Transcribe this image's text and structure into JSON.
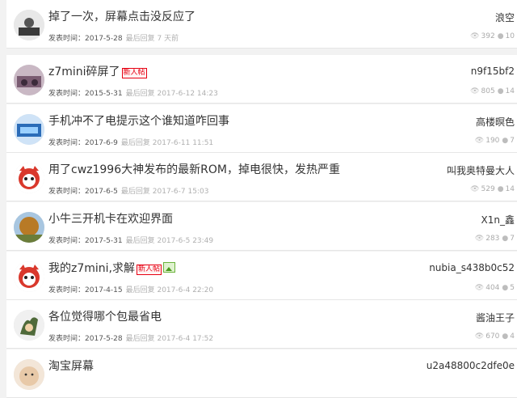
{
  "threads": [
    {
      "title": "掉了一次，屏幕点击没反应了",
      "badge": "",
      "has_image": false,
      "post_label": "发表时间：",
      "post_date": "2017-5-28",
      "reply_label": "最后回复",
      "reply_time": "7 天前",
      "author": "浪空",
      "views": "392",
      "replies": "10",
      "avatar_color": "#3a3a3a"
    },
    {
      "title": "z7mini碎屏了",
      "badge": "新人帖",
      "has_image": false,
      "post_label": "发表时间：",
      "post_date": "2015-5-31",
      "reply_label": "最后回复",
      "reply_time": "2017-6-12 14:23",
      "author": "n9f15bf2",
      "views": "805",
      "replies": "14",
      "avatar_color": "#7a5c72"
    },
    {
      "title": "手机冲不了电提示这个谁知道咋回事",
      "badge": "",
      "has_image": false,
      "post_label": "发表时间：",
      "post_date": "2017-6-9",
      "reply_label": "最后回复",
      "reply_time": "2017-6-11 11:51",
      "author": "高楼暝色",
      "views": "190",
      "replies": "7",
      "avatar_color": "#2b6cb8"
    },
    {
      "title": "用了cwz1996大神发布的最新ROM，掉电很快，发热严重",
      "badge": "",
      "has_image": false,
      "post_label": "发表时间：",
      "post_date": "2017-6-5",
      "reply_label": "最后回复",
      "reply_time": "2017-6-7 15:03",
      "author": "叫我奥特曼大人",
      "views": "529",
      "replies": "14",
      "avatar_color": "#d9382c"
    },
    {
      "title": "小牛三开机卡在欢迎界面",
      "badge": "",
      "has_image": false,
      "post_label": "发表时间：",
      "post_date": "2017-5-31",
      "reply_label": "最后回复",
      "reply_time": "2017-6-5 23:49",
      "author": "X1n_鑫",
      "views": "283",
      "replies": "7",
      "avatar_color": "#b87a26"
    },
    {
      "title": "我的z7mini,求解",
      "badge": "新人帖",
      "has_image": true,
      "post_label": "发表时间：",
      "post_date": "2017-4-15",
      "reply_label": "最后回复",
      "reply_time": "2017-6-4 22:20",
      "author": "nubia_s438b0c52",
      "views": "404",
      "replies": "5",
      "avatar_color": "#d9382c"
    },
    {
      "title": "各位觉得哪个包最省电",
      "badge": "",
      "has_image": false,
      "post_label": "发表时间：",
      "post_date": "2017-5-28",
      "reply_label": "最后回复",
      "reply_time": "2017-6-4 17:52",
      "author": "酱油王子",
      "views": "670",
      "replies": "4",
      "avatar_color": "#4f6a3a"
    },
    {
      "title": "淘宝屏幕",
      "badge": "",
      "has_image": false,
      "post_label": "",
      "post_date": "",
      "reply_label": "",
      "reply_time": "",
      "author": "u2a48800c2dfe0e",
      "views": "",
      "replies": "",
      "avatar_color": "#e8c9a8"
    }
  ],
  "icons": {
    "views": "eye-icon",
    "replies": "comment-icon"
  }
}
